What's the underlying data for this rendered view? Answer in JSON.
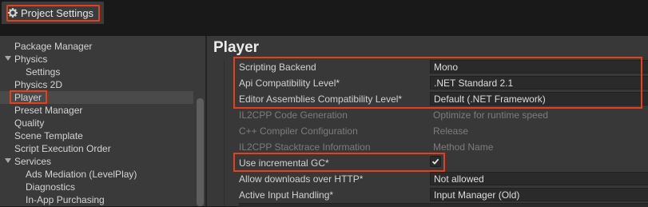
{
  "window": {
    "tab_title": "Project Settings",
    "tab_icon": "gear-icon"
  },
  "sidebar": {
    "items": [
      {
        "label": "Package Manager"
      },
      {
        "label": "Physics",
        "expanded": true
      },
      {
        "label": "Settings"
      },
      {
        "label": "Physics 2D"
      },
      {
        "label": "Player",
        "selected": true
      },
      {
        "label": "Preset Manager"
      },
      {
        "label": "Quality"
      },
      {
        "label": "Scene Template"
      },
      {
        "label": "Script Execution Order"
      },
      {
        "label": "Services",
        "expanded": true
      },
      {
        "label": "Ads Mediation (LevelPlay)"
      },
      {
        "label": "Diagnostics"
      },
      {
        "label": "In-App Purchasing"
      }
    ]
  },
  "main": {
    "title": "Player",
    "rows": [
      {
        "label": "Scripting Backend",
        "value": "Mono",
        "enabled": true
      },
      {
        "label": "Api Compatibility Level*",
        "value": ".NET Standard 2.1",
        "enabled": true
      },
      {
        "label": "Editor Assemblies Compatibility Level*",
        "value": "Default (.NET Framework)",
        "enabled": true
      },
      {
        "label": "IL2CPP Code Generation",
        "value": "Optimize for runtime speed",
        "enabled": false
      },
      {
        "label": "C++ Compiler Configuration",
        "value": "Release",
        "enabled": false
      },
      {
        "label": "IL2CPP Stacktrace Information",
        "value": "Method Name",
        "enabled": false
      },
      {
        "label": "Use incremental GC*",
        "checked": true,
        "enabled": true
      },
      {
        "label": "Allow downloads over HTTP*",
        "value": "Not allowed",
        "enabled": true
      },
      {
        "label": "Active Input Handling*",
        "value": "Input Manager (Old)",
        "enabled": true
      }
    ]
  },
  "colors": {
    "highlight": "#e6401a",
    "background": "#383838",
    "field": "#2a2a2a"
  }
}
